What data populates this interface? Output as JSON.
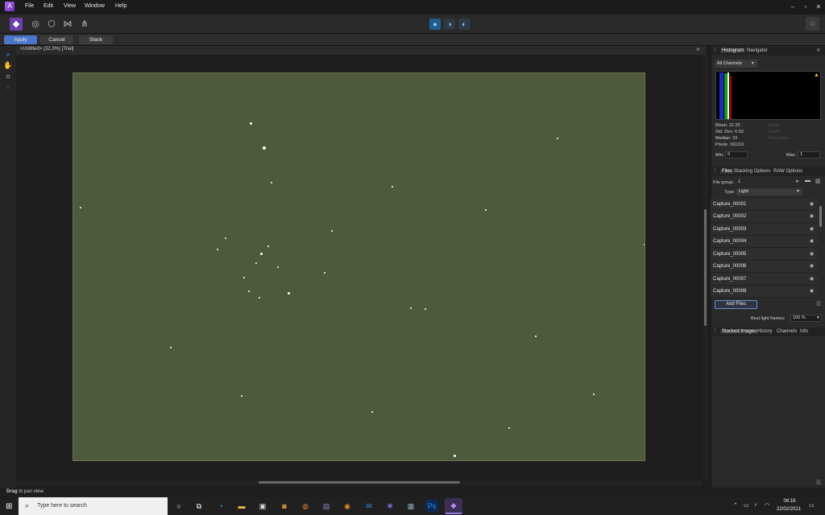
{
  "menu": {
    "logo": "A",
    "items": [
      "File",
      "Edit",
      "View",
      "Window",
      "Help"
    ],
    "window_controls": [
      "–",
      "▫",
      "✕"
    ]
  },
  "context_bar": {
    "apply": "Apply",
    "cancel": "Cancel",
    "stack": "Stack"
  },
  "document": {
    "tab_title": "<Untitled> (32.3%) [Trial]",
    "close": "×"
  },
  "histogram_panel": {
    "tabs": [
      "Histogram",
      "Navigator"
    ],
    "channel": "All Channels",
    "warning_icon": "▲",
    "stats": {
      "mean": "Mean: 22.20",
      "std_dev": "Std. Dev: 6.53",
      "median": "Median: 23",
      "pixels": "Pixels: 181116"
    },
    "stats_right": {
      "level": "Level:",
      "count": "Count:",
      "percentile": "Percentile:"
    },
    "min_label": "Min:",
    "min_value": "0",
    "max_label": "Max:",
    "max_value": "1"
  },
  "files_panel": {
    "tabs": [
      "Files",
      "Stacking Options",
      "RAW Options"
    ],
    "file_group_label": "File group:",
    "file_group_value": "1",
    "type_label": "Type:",
    "type_value": "Light",
    "files": [
      "Capture_00001",
      "Capture_00002",
      "Capture_00003",
      "Capture_00004",
      "Capture_00005",
      "Capture_00006",
      "Capture_00007",
      "Capture_00008"
    ],
    "add_files": "Add Files",
    "best_light_label": "Best light frames:",
    "best_light_value": "100 %"
  },
  "bottom_panel": {
    "tabs": [
      "Stacked Images",
      "History",
      "Channels",
      "Info"
    ]
  },
  "status": {
    "bold": "Drag",
    "text": " to pan view."
  },
  "taskbar": {
    "search_placeholder": "Type here to search",
    "time": "06:16",
    "date": "22/02/2021"
  },
  "colors": {
    "accent": "#4a76c9",
    "image_bg": "#4e5a3b",
    "panel_bg": "#2a2a2a"
  }
}
